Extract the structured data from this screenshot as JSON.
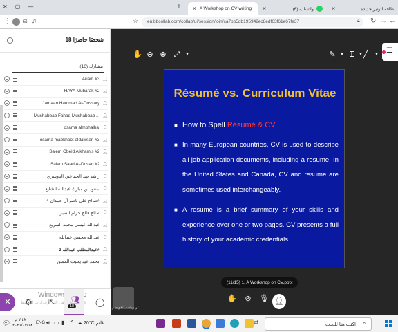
{
  "browser": {
    "tabs": [
      {
        "label": "طاقة لتوتير جديدة",
        "active": false
      },
      {
        "label": "(6) واتساب",
        "active": false
      },
      {
        "label": "A Workshop on CV writing",
        "active": true
      }
    ],
    "new_tab": "+",
    "url": "eu.bbcollab.com/collab/ui/session/join/ca7bb5db195942ec8edf63f61e67fe37"
  },
  "sidebar": {
    "attendees_title": "18 شخصًا حاضرًا",
    "section_label": "مشارك (16)",
    "participants": [
      {
        "name": "Ariam #3",
        "bold": false
      },
      {
        "name": "HAYA Mubarak #2",
        "bold": false
      },
      {
        "name": "Jamaan Hammad Al-Dossary",
        "bold": false
      },
      {
        "name": "Mushabbab Fahad Mushabbab ...",
        "bold": false
      },
      {
        "name": "osama almohalhal",
        "bold": false
      },
      {
        "name": "osama mabkhoot aldawsari #3",
        "bold": false
      },
      {
        "name": "Salem Obeid Alkhamis #2",
        "bold": false
      },
      {
        "name": "Salem Saad Al-Dosari #2",
        "bold": false
      },
      {
        "name": "راشد فهد الجماعين الدوسري",
        "bold": false
      },
      {
        "name": "سعود بن مبارك عبدالله الشايع",
        "bold": false
      },
      {
        "name": "صالح علي ناصر آل حمدان 4#",
        "bold": false
      },
      {
        "name": "صالح فالح حزام الصبر",
        "bold": false
      },
      {
        "name": "عبدالله عيسى محمد السريع",
        "bold": false
      },
      {
        "name": "عبدالله محسن عبدالله",
        "bold": false
      },
      {
        "name": "عبدالمطلب عبدالله 3#",
        "bold": true
      },
      {
        "name": "محمد عيد يعثيث المسن",
        "bold": false
      }
    ],
    "badge_count": "18",
    "watermark_line1": "Windows تنشيط",
    "watermark_line2": "انتقل إلى الإعدادات لتنشيط Windows"
  },
  "stage": {
    "slide": {
      "title": "Résumé vs. Curriculum Vitae",
      "bullet1_prefix": "How to Spell ",
      "bullet1_highlight": "Résumé & CV",
      "bullet2": "In many European countries, CV is used to describe all job application documents, including a resume. In the United States and Canada, CV and resume are sometimes used interchangeably.",
      "bullet3": "A resume is a brief summary of your skills and experience over one or two pages. CV presents a full history of your academic credentials"
    },
    "page_indicator": "(11/15)",
    "file_name": "1. A Workshop on CV.pptx",
    "presenter_name": "تربويات . تقويم ز..."
  },
  "taskbar": {
    "search_placeholder": "اكتب هنا للبحث",
    "weather": "20°C",
    "weather_label": "غائم",
    "time": "۰٧:٤٢ م",
    "date": "۲۰۲۱/۰۳/۱٨",
    "lang": "ENG"
  },
  "colors": {
    "slide_bg": "#0a1aa0",
    "slide_title": "#f2c12e",
    "highlight": "#ff3b3b",
    "accent_purple": "#8e44ad"
  }
}
